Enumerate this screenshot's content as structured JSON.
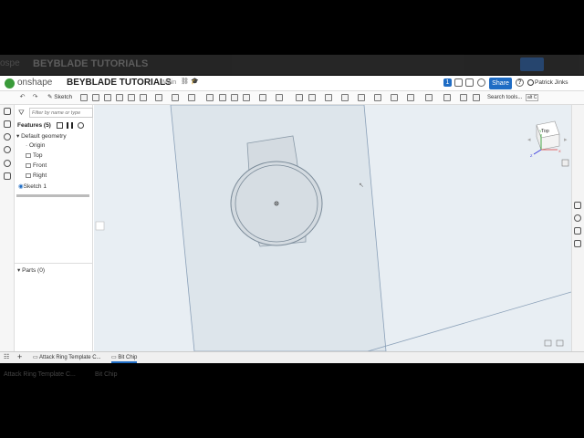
{
  "ghost": {
    "title": "BEYBLADE TUTORIALS",
    "logo_text": "ospe",
    "tab1": "Attack Ring Template C...",
    "tab2": "Bit Chip"
  },
  "app": {
    "brand": "onshape",
    "document_title": "BEYBLADE TUTORIALS",
    "branch": "Main",
    "share_label": "Share",
    "help_label": "?",
    "user_name": "Patrick Jinks",
    "notification_count": "1"
  },
  "toolbar": {
    "sketch_label": "Sketch",
    "search_tools": "Search tools...",
    "search_shortcut": "alt C"
  },
  "feature_panel": {
    "filter_placeholder": "Filter by name or type",
    "features_header": "Features (5)",
    "default_geometry": "Default geometry",
    "items": [
      {
        "label": "Origin"
      },
      {
        "label": "Top"
      },
      {
        "label": "Front"
      },
      {
        "label": "Right"
      },
      {
        "label": "Sketch 1"
      }
    ],
    "parts_header": "Parts (0)"
  },
  "viewcube": {
    "face_label": "Top",
    "axis_x": "X",
    "axis_y": "Y",
    "axis_z": "Z"
  },
  "tabs": [
    {
      "label": "Attack Ring Template C..."
    },
    {
      "label": "Bit Chip"
    }
  ],
  "colors": {
    "share": "#1f6cc4",
    "viewport_bg": "#e8eef3",
    "plane_fill": "#dde5eb",
    "sketch_fill": "#d4dbe1",
    "brand_green": "#3a9b3a"
  }
}
